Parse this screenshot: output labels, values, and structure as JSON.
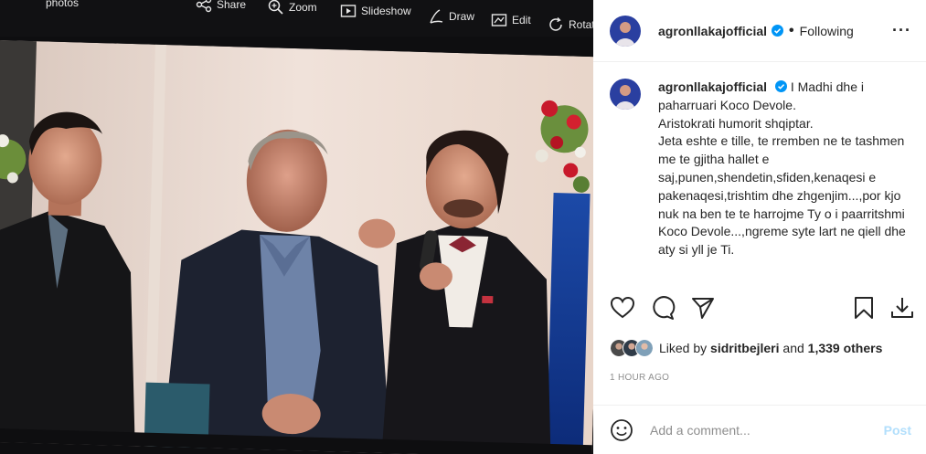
{
  "photo_toolbar": {
    "items": [
      {
        "label": "Share",
        "icon": "share-icon"
      },
      {
        "label": "Zoom",
        "icon": "zoom-icon"
      },
      {
        "label": "Slideshow",
        "icon": "slideshow-icon"
      },
      {
        "label": "Draw",
        "icon": "draw-icon"
      },
      {
        "label": "Edit",
        "icon": "edit-icon"
      },
      {
        "label": "Rotate",
        "icon": "rotate-icon"
      }
    ],
    "left_label": "photos"
  },
  "post": {
    "username": "agronllakajofficial",
    "verified": true,
    "follow_status": "Following",
    "caption": "I Madhi dhe i paharruari Koco Devole.\nAristokrati humorit shqiptar.\nJeta eshte e tille, te rremben ne te tashmen me te gjitha hallet e saj,punen,shendetin,sfiden,kenaqesi e pakenaqesi,trishtim dhe zhgenjim...,por kjo nuk na ben te te harrojme Ty o i paarritshmi Koco Devole...,ngreme syte lart ne qiell dhe aty si yll je Ti.",
    "likes": {
      "prefix": "Liked by",
      "user": "sidritbejleri",
      "joiner": "and",
      "others": "1,339 others"
    },
    "timestamp": "1 HOUR AGO",
    "comment_placeholder": "Add a comment...",
    "post_button": "Post"
  },
  "colors": {
    "verified_blue": "#0095f6",
    "post_button_disabled": "#b2dffc",
    "muted_text": "#8e8e8e"
  }
}
